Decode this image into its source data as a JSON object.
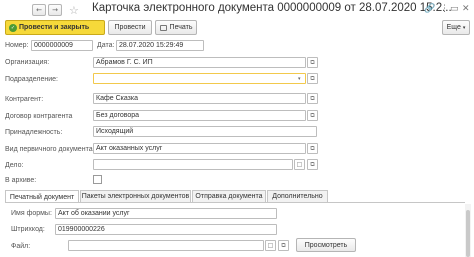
{
  "window": {
    "title": "Карточка электронного документа 0000000009 от 28.07.2020 15:2...",
    "nav_back": "←",
    "nav_forward": "→",
    "star": "☆",
    "link_icon": "🔗",
    "menu_icon": "⋮",
    "maximize_icon": "▭",
    "close_icon": "✕"
  },
  "toolbar": {
    "post_and_close": "Провести и закрыть",
    "post": "Провести",
    "print": "Печать",
    "more": "Еще",
    "more_arrow": "▾",
    "check_glyph": "✓"
  },
  "fields": {
    "number_label": "Номер:",
    "number_value": "0000000009",
    "date_label": "Дата:",
    "date_value": "28.07.2020 15:29:49",
    "organization_label": "Организация:",
    "organization_value": "Абрамов Г. С. ИП",
    "division_label": "Подразделение:",
    "division_value": "",
    "counterparty_label": "Контрагент:",
    "counterparty_value": "Кафе Сказка",
    "contract_label": "Договор контрагента",
    "contract_value": "Без договора",
    "affiliation_label": "Принадлежность:",
    "affiliation_value": "Исходящий",
    "primary_doc_type_label": "Вид первичного документа:",
    "primary_doc_type_value": "Акт оказанных услуг",
    "case_label": "Дело:",
    "case_value": "",
    "archive_label": "В архиве:",
    "select_glyph": "□",
    "open_glyph": "⧉",
    "dropdown_glyph": "▾"
  },
  "tabs": [
    "Печатный документ",
    "Пакеты электронных документов",
    "Отправка документа",
    "Дополнительно"
  ],
  "print_tab": {
    "form_name_label": "Имя формы:",
    "form_name_value": "Акт об оказании услуг",
    "barcode_label": "Штрихкод:",
    "barcode_value": "019900000226",
    "file_label": "Файл:",
    "file_value": "",
    "view_button": "Просмотреть"
  },
  "colors": {
    "primary_button": "#f6d93a",
    "active_field_border": "#f2c94c",
    "check_green": "#4c9b34"
  }
}
